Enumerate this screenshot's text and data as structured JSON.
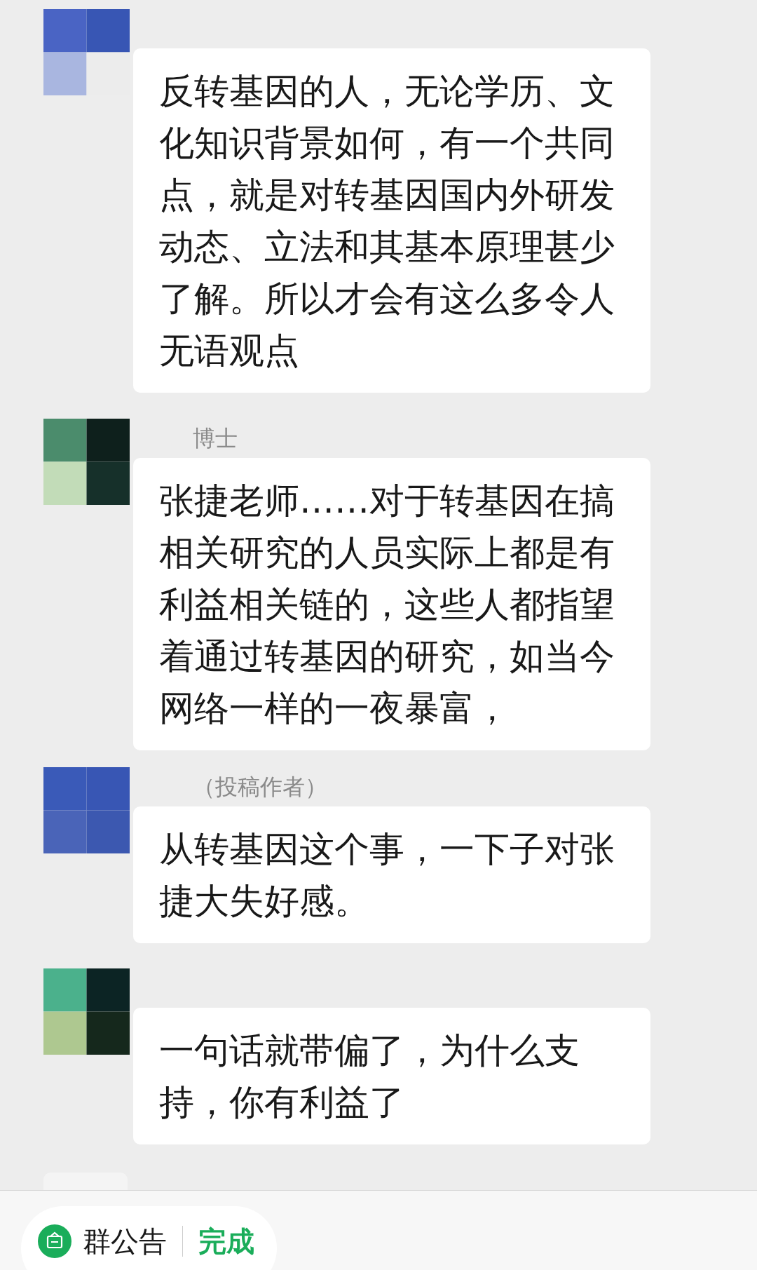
{
  "messages": [
    {
      "text": "反转基因的人，无论学历、文化知识背景如何，有一个共同点，就是对转基因国内外研发动态、立法和其基本原理甚少了解。所以才会有这么多令人无语观点"
    },
    {
      "sender": "博士",
      "text": "张捷老师……对于转基因在搞相关研究的人员实际上都是有利益相关链的，这些人都指望着通过转基因的研究，如当今网络一样的一夜暴富，"
    },
    {
      "sender": "（投稿作者）",
      "text": "从转基因这个事，一下子对张捷大失好感。"
    },
    {
      "text": "一句话就带偏了，为什么支持，你有利益了"
    }
  ],
  "bottom_bar": {
    "notice": "群公告",
    "action": "完成"
  }
}
